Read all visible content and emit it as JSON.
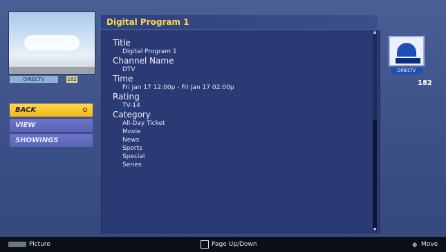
{
  "left_panel": {
    "thumb_label": "DIRECTV",
    "thumb_channel": "182",
    "menu": [
      {
        "label": "BACK",
        "active": true
      },
      {
        "label": "VIEW",
        "active": false
      },
      {
        "label": "SHOWINGS",
        "active": false
      }
    ]
  },
  "main": {
    "title": "Digital Program 1",
    "fields": {
      "title_label": "Title",
      "title_value": "Digital Program 1",
      "channel_label": "Channel Name",
      "channel_value": "DTV",
      "time_label": "Time",
      "time_value": "Fri Jan 17 12:00p - Fri Jan 17 02:00p",
      "rating_label": "Rating",
      "rating_value": "TV-14",
      "category_label": "Category",
      "category_values": [
        "All-Day Ticket",
        "Movie",
        "News",
        "Sports",
        "Special",
        "Series"
      ]
    }
  },
  "right_panel": {
    "logo_label": "DIRECTV",
    "channel_number": "182"
  },
  "footer": {
    "picture": "Picture",
    "page": "Page Up/Down",
    "move": "Move"
  },
  "colors": {
    "background": "#3b4f86",
    "panel": "#2a3a74",
    "accent_yellow": "#ffd84a",
    "menu_purple": "#6c75c8",
    "footer": "#0b0f18"
  }
}
